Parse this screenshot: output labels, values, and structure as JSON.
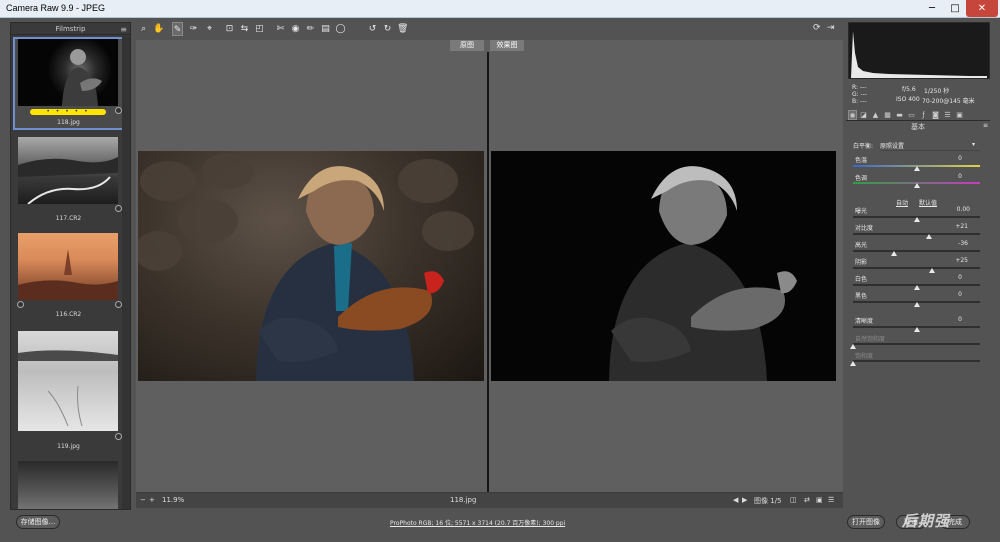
{
  "window": {
    "title": "Camera Raw 9.9  -  JPEG",
    "min": "─",
    "max": "□",
    "close": "✕"
  },
  "filmstrip": {
    "header": "Filmstrip",
    "menu": "≡",
    "items": [
      {
        "file": "118.jpg",
        "rating": "• • • • •"
      },
      {
        "file": "117.CR2"
      },
      {
        "file": "116.CR2"
      },
      {
        "file": "119.jpg"
      }
    ]
  },
  "toolbar": {
    "icons": [
      "⌕",
      "✋",
      "✎",
      "✑",
      "⌖",
      "⊡",
      "⇆",
      "◰",
      "✄",
      "◉",
      "✏",
      "▤",
      "◯",
      "↺",
      "↻",
      "🗑"
    ],
    "right": [
      "⟳",
      "⇥"
    ]
  },
  "view": {
    "before_label": "原图",
    "after_label": "效果图"
  },
  "status": {
    "zoom": "11.9%",
    "zoom_minus": "−",
    "zoom_plus": "+",
    "filename": "118.jpg",
    "image_count": "图像 1/5",
    "prev": "◀",
    "next": "▶"
  },
  "histogram": {
    "r": "R: ---",
    "g": "G: ---",
    "b": "B: ---",
    "fstop": "f/5.6",
    "shutter": "1/250 秒",
    "iso": "ISO 400",
    "lens": "70-200@145 毫米"
  },
  "panel": {
    "title": "基本",
    "menu": "≡",
    "white_balance_label": "白平衡:",
    "white_balance_value": "原照设置",
    "auto": "自动",
    "default": "默认值",
    "sliders": [
      {
        "label": "色温",
        "value": "0",
        "pos": 0.5
      },
      {
        "label": "色调",
        "value": "0",
        "pos": 0.5
      },
      {
        "label": "曝光",
        "value": "0.00",
        "pos": 0.5
      },
      {
        "label": "对比度",
        "value": "+21",
        "pos": 0.6
      },
      {
        "label": "高光",
        "value": "-36",
        "pos": 0.32
      },
      {
        "label": "阴影",
        "value": "+25",
        "pos": 0.62
      },
      {
        "label": "白色",
        "value": "0",
        "pos": 0.5
      },
      {
        "label": "黑色",
        "value": "0",
        "pos": 0.5
      },
      {
        "label": "清晰度",
        "value": "0",
        "pos": 0.5
      },
      {
        "label": "自然饱和度",
        "value": "",
        "pos": 0.0
      },
      {
        "label": "饱和度",
        "value": "",
        "pos": 0.0
      }
    ]
  },
  "footer": {
    "save": "存储图像...",
    "workflow": "ProPhoto RGB; 16 位; 5571 x 3714 (20.7 百万像素); 300 ppi",
    "open": "打开图像",
    "cancel": "取消",
    "done": "完成",
    "watermark": "后期强"
  },
  "colors": {
    "accent": "#6f8fd0",
    "stars": "#ffe400",
    "close": "#c7463b"
  }
}
